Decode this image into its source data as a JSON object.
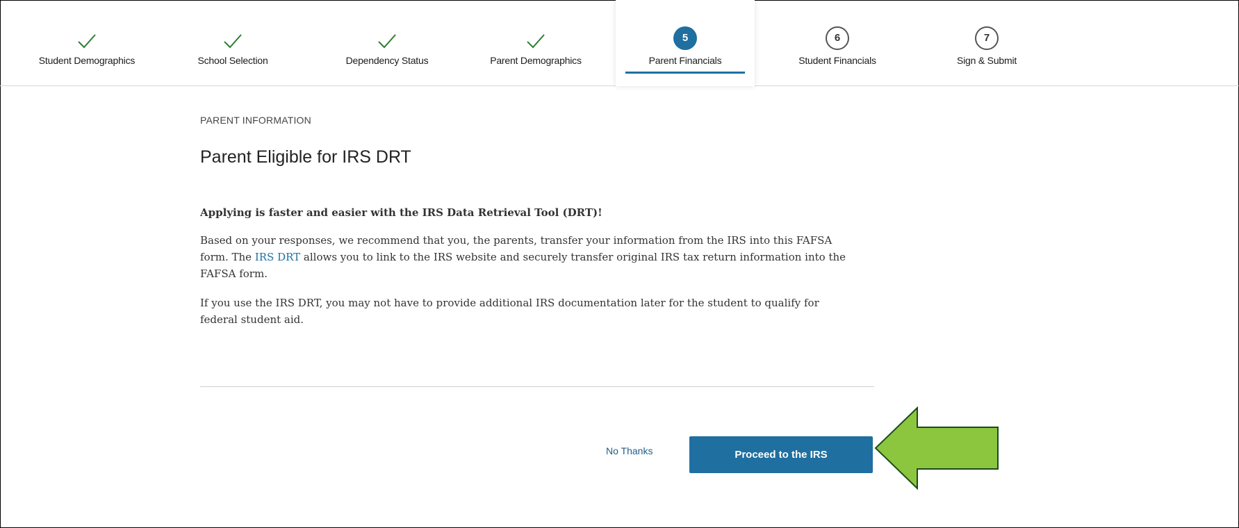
{
  "steps": [
    {
      "label": "Student Demographics",
      "status": "complete",
      "icon": "checkmark-icon"
    },
    {
      "label": "School Selection",
      "status": "complete",
      "icon": "checkmark-icon"
    },
    {
      "label": "Dependency Status",
      "status": "complete",
      "icon": "checkmark-icon"
    },
    {
      "label": "Parent Demographics",
      "status": "complete",
      "icon": "checkmark-icon"
    },
    {
      "number": "5",
      "label": "Parent Financials",
      "status": "current"
    },
    {
      "number": "6",
      "label": "Student Financials",
      "status": "upcoming"
    },
    {
      "number": "7",
      "label": "Sign & Submit",
      "status": "upcoming"
    }
  ],
  "page": {
    "kicker": "PARENT INFORMATION",
    "title": "Parent Eligible for IRS DRT",
    "lead": "Applying is faster and easier with the IRS Data Retrieval Tool (DRT)!",
    "p1_before": "Based on your responses, we recommend that you, the parents, transfer your information from the IRS into this FAFSA form. The ",
    "p1_link": "IRS DRT",
    "p1_after": " allows you to link to the IRS website and securely transfer original IRS tax return information into the FAFSA form.",
    "p2": "If you use the IRS DRT, you may not have to provide additional IRS documentation later for the student to qualify for federal student aid."
  },
  "actions": {
    "no_thanks": "No Thanks",
    "proceed": "Proceed to the IRS"
  },
  "colors": {
    "accent": "#1f6fa0",
    "check": "#2e7d32",
    "annotation_arrow": "#8cc63f"
  }
}
